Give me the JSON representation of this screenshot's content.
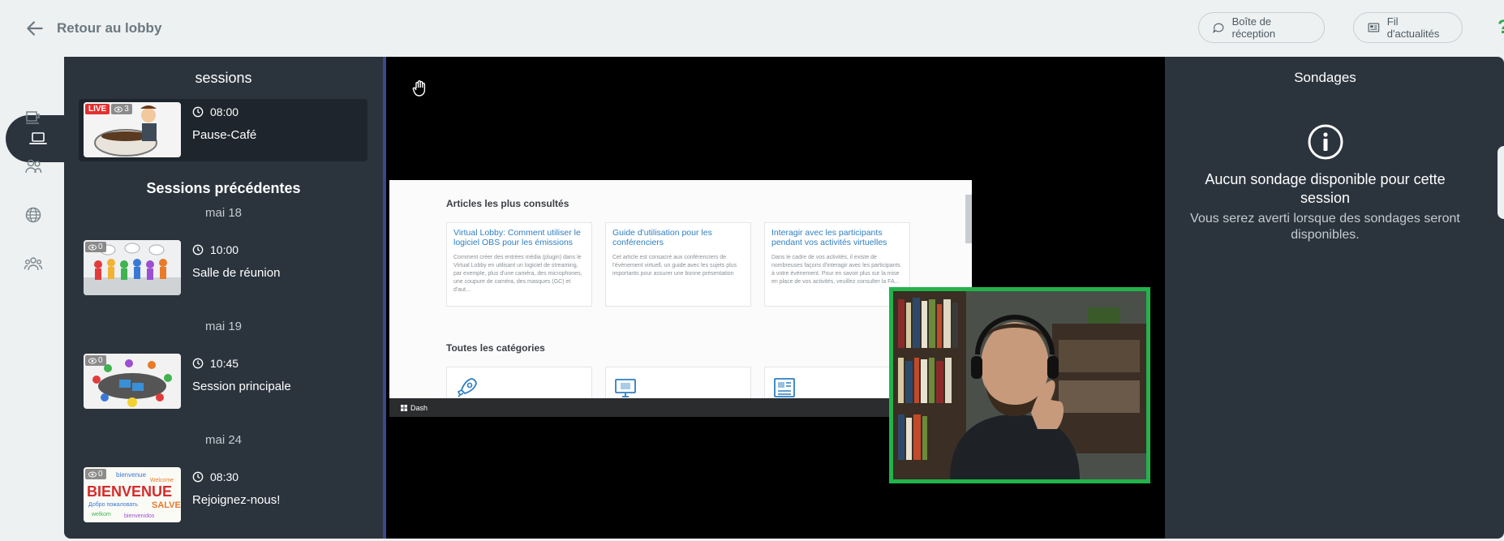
{
  "header": {
    "back_label": "Retour au lobby",
    "inbox_label": "Boîte de réception",
    "feed_label": "Fil d'actualités"
  },
  "sessions_panel": {
    "title": "sessions",
    "current": {
      "live_badge": "LIVE",
      "viewers": "3",
      "time": "08:00",
      "name": "Pause-Café"
    },
    "previous_title": "Sessions précédentes",
    "groups": [
      {
        "date": "mai 18",
        "viewers": "0",
        "time": "10:00",
        "name": "Salle de réunion"
      },
      {
        "date": "mai 19",
        "viewers": "0",
        "time": "10:45",
        "name": "Session principale"
      },
      {
        "date": "mai 24",
        "viewers": "0",
        "time": "08:30",
        "name": "Rejoignez-nous!"
      }
    ]
  },
  "screen_share": {
    "most_viewed_heading": "Articles les plus consultés",
    "articles": [
      {
        "title": "Virtual Lobby: Comment utiliser le logiciel OBS pour les émissions",
        "body": "Comment créer des entrées média (plugin) dans le Virtual Lobby en utilisant un logiciel de streaming, par exemple, plus d'une caméra, des microphones, une coupure de caméra, des masques (GC) et d'aut..."
      },
      {
        "title": "Guide d'utilisation pour les conférenciers",
        "body": "Cet article est consacré aux conférenciers de l'événement virtuell, un guide avec les sujets plus importants pour assurer une bonne présentation"
      },
      {
        "title": "Interagir avec les participants pendant vos activités virtuelles",
        "body": "Dans le cadre de vos activités, il existe de nombreuses façons d'interagir avec les participants à votre événement. Pour en savoir plus sur la mise en place de vos activités, veuillez consulter la FA..."
      }
    ],
    "categories_heading": "Toutes les catégories",
    "taskbar_label": "Dash"
  },
  "polls_panel": {
    "title": "Sondages",
    "empty_title": "Aucun sondage disponible pour cette session",
    "empty_note": "Vous serez averti lorsque des sondages seront disponibles."
  },
  "colors": {
    "panel": "#2b343d",
    "background": "#eef1f2",
    "live": "#e33030",
    "camera_border": "#22b34a",
    "link": "#2f7fc1"
  },
  "icons": [
    "arrow-left-icon",
    "chat-bubble-icon",
    "newspaper-icon",
    "laptop-icon",
    "coffee-icon",
    "people-icon",
    "globe-icon",
    "group-icon",
    "clock-icon",
    "eye-icon",
    "hand-icon",
    "info-icon",
    "rocket-icon"
  ]
}
